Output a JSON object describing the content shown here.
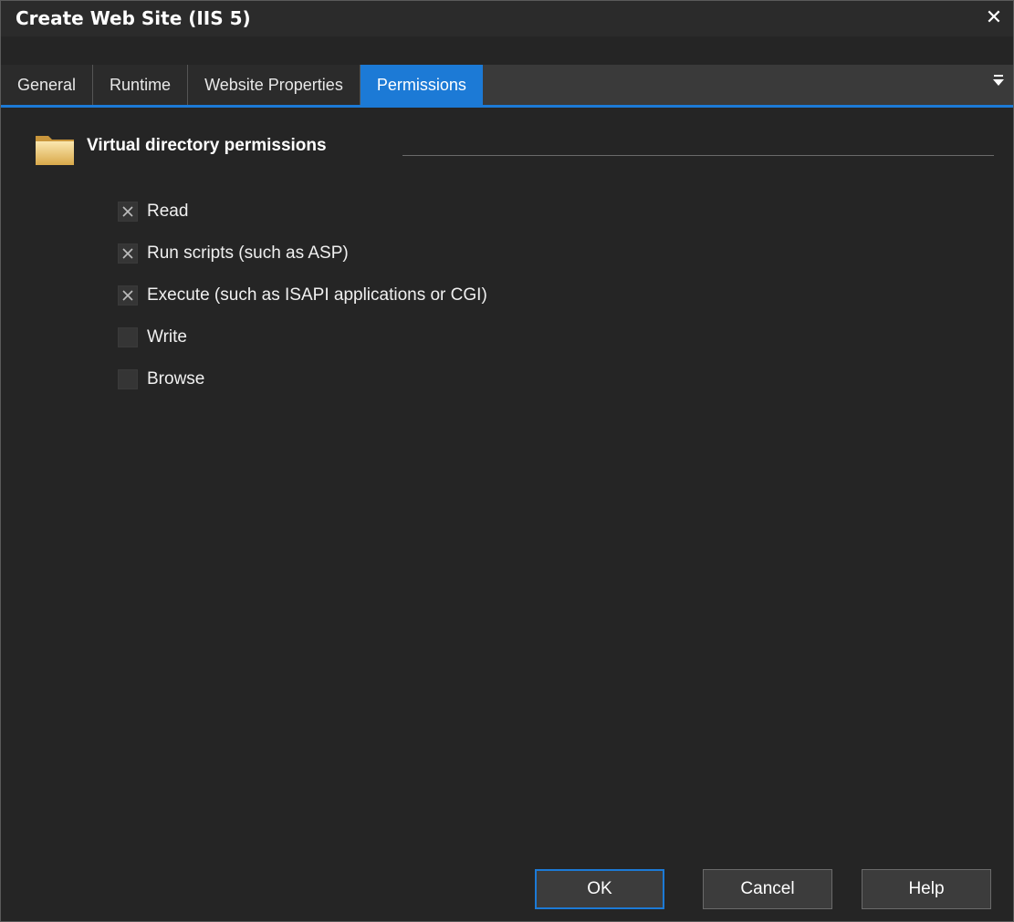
{
  "window": {
    "title": "Create Web Site (IIS 5)"
  },
  "tabs": [
    {
      "label": "General",
      "active": false
    },
    {
      "label": "Runtime",
      "active": false
    },
    {
      "label": "Website Properties",
      "active": false
    },
    {
      "label": "Permissions",
      "active": true
    }
  ],
  "group": {
    "title": "Virtual directory permissions",
    "icon": "folder-icon"
  },
  "permissions": [
    {
      "label": "Read",
      "checked": true
    },
    {
      "label": "Run scripts (such as ASP)",
      "checked": true
    },
    {
      "label": "Execute (such as ISAPI applications or CGI)",
      "checked": true
    },
    {
      "label": "Write",
      "checked": false
    },
    {
      "label": "Browse",
      "checked": false
    }
  ],
  "buttons": {
    "ok": "OK",
    "cancel": "Cancel",
    "help": "Help"
  },
  "colors": {
    "accent": "#1c7ad6",
    "background": "#252525"
  }
}
